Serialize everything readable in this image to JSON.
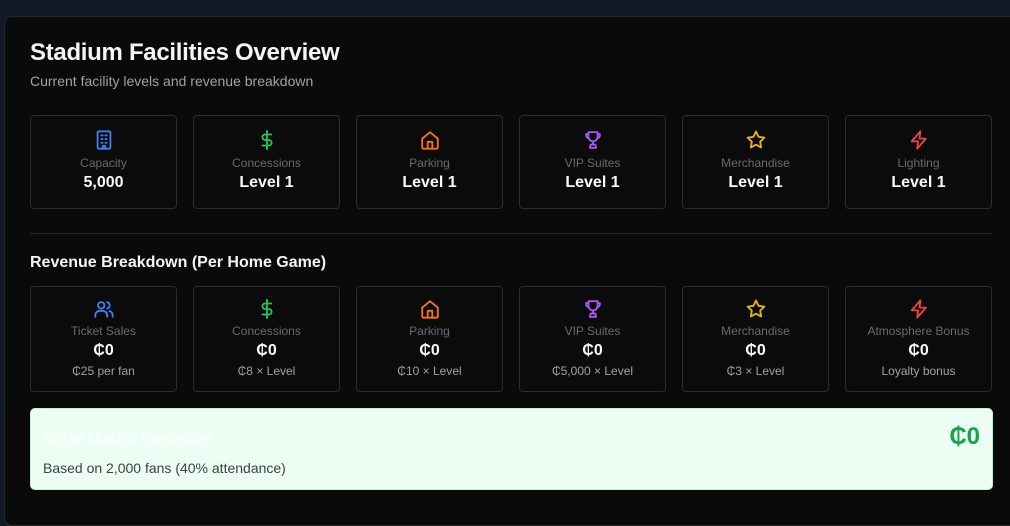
{
  "header": {
    "title": "Stadium Facilities Overview",
    "subtitle": "Current facility levels and revenue breakdown"
  },
  "facilities": [
    {
      "icon": "building-icon",
      "color": "#3b82f6",
      "label": "Capacity",
      "value": "5,000"
    },
    {
      "icon": "dollar-icon",
      "color": "#22c55e",
      "label": "Concessions",
      "value": "Level 1"
    },
    {
      "icon": "home-icon",
      "color": "#f97316",
      "label": "Parking",
      "value": "Level 1"
    },
    {
      "icon": "trophy-icon",
      "color": "#a855f7",
      "label": "VIP Suites",
      "value": "Level 1"
    },
    {
      "icon": "star-icon",
      "color": "#eab308",
      "label": "Merchandise",
      "value": "Level 1"
    },
    {
      "icon": "lightning-icon",
      "color": "#ef4444",
      "label": "Lighting",
      "value": "Level 1"
    }
  ],
  "revenue": {
    "title": "Revenue Breakdown (Per Home Game)",
    "items": [
      {
        "icon": "users-icon",
        "color": "#3b82f6",
        "label": "Ticket Sales",
        "value": "₵0",
        "note": "₵25 per fan"
      },
      {
        "icon": "dollar-icon",
        "color": "#22c55e",
        "label": "Concessions",
        "value": "₵0",
        "note": "₵8 × Level"
      },
      {
        "icon": "home-icon",
        "color": "#f97316",
        "label": "Parking",
        "value": "₵0",
        "note": "₵10 × Level"
      },
      {
        "icon": "trophy-icon",
        "color": "#a855f7",
        "label": "VIP Suites",
        "value": "₵0",
        "note": "₵5,000 × Level"
      },
      {
        "icon": "star-icon",
        "color": "#eab308",
        "label": "Merchandise",
        "value": "₵0",
        "note": "₵3 × Level"
      },
      {
        "icon": "lightning-icon",
        "color": "#ef4444",
        "label": "Atmosphere Bonus",
        "value": "₵0",
        "note": "Loyalty bonus"
      }
    ]
  },
  "total": {
    "label": "Total Match Revenue",
    "value": "₵0",
    "note": "Based on 2,000 fans (40% attendance)"
  }
}
